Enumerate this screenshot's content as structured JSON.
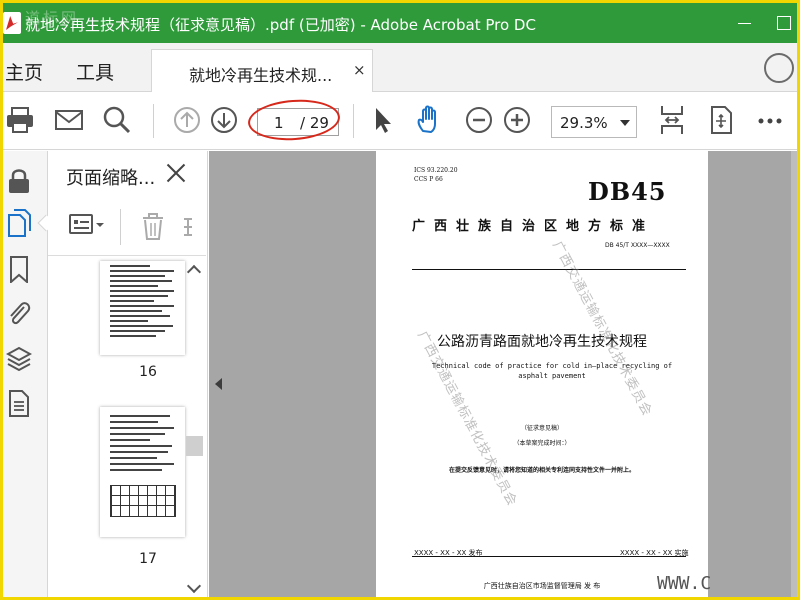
{
  "window": {
    "title": "就地冷再生技术规程（征求意见稿）.pdf (已加密) - Adobe Acrobat Pro DC",
    "logo_text": "道标网"
  },
  "tabs": {
    "home": "主页",
    "tools": "工具",
    "document_tab": "就地冷再生技术规...",
    "close_glyph": "×"
  },
  "toolbar": {
    "icons": [
      "print-icon",
      "email-icon",
      "search-icon",
      "previous-page-icon",
      "next-page-icon",
      "select-cursor-icon",
      "hand-tool-icon",
      "zoom-out-icon",
      "zoom-in-icon",
      "fit-page-icon",
      "scrolling-mode-icon",
      "more-tools-icon"
    ],
    "current_page": "1",
    "total_pages": "/ 29",
    "zoom": "29.3%"
  },
  "left_rail": {
    "icons": [
      "lock-icon",
      "pages-icon",
      "bookmark-icon",
      "attachment-icon",
      "layers-icon",
      "document-properties-icon"
    ]
  },
  "thumbnails_panel": {
    "title": "页面缩略...",
    "thumbnails": [
      {
        "page": "16"
      },
      {
        "page": "17"
      }
    ]
  },
  "document_page": {
    "ics_line1": "ICS  93.220.20",
    "ics_line2": "CCS  P 66",
    "std_code": "DB45",
    "standard_header": "广西壮族自治区地方标准",
    "std_number": "DB 45/T XXXX—XXXX",
    "title_cn": "公路沥青路面就地冷再生技术规程",
    "title_en": "Technical code of practice for cold in–place recycling of asphalt pavement",
    "draft_label": "（征求意见稿）",
    "draft_note": "（本草案完成时间：）",
    "comment_note": "在提交反馈意见时，请将您知道的相关专利连同支持性文件一并附上。",
    "issue_date": "XXXX - XX - XX 发布",
    "impl_date": "XXXX - XX - XX 实施",
    "publisher": "广西壮族自治区市场监督管理局    发 布",
    "watermark_1": "广西交通运输标准化技术委员会",
    "watermark_2": "广西交通运输标准化技术委员会",
    "site_watermark": "WWW.C"
  }
}
